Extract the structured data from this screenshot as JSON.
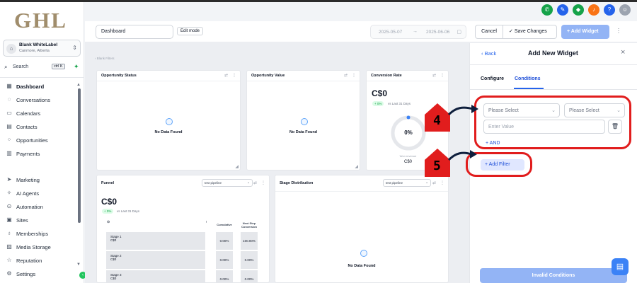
{
  "brand": {
    "logo": "GHL"
  },
  "location": {
    "name": "Blank WhiteLabel",
    "sub": "Canmore, Alberta"
  },
  "search": {
    "label": "Search",
    "shortcut": "ctrl K"
  },
  "nav": [
    {
      "label": "Dashboard",
      "icon": "dashboard-icon",
      "active": true
    },
    {
      "label": "Conversations",
      "icon": "chat-icon"
    },
    {
      "label": "Calendars",
      "icon": "calendar-icon"
    },
    {
      "label": "Contacts",
      "icon": "contacts-icon"
    },
    {
      "label": "Opportunities",
      "icon": "opportunities-icon"
    },
    {
      "label": "Payments",
      "icon": "payments-icon"
    },
    {
      "label": "Marketing",
      "icon": "send-icon"
    },
    {
      "label": "AI Agents",
      "icon": "ai-icon"
    },
    {
      "label": "Automation",
      "icon": "automation-icon"
    },
    {
      "label": "Sites",
      "icon": "sites-icon"
    },
    {
      "label": "Memberships",
      "icon": "memberships-icon"
    },
    {
      "label": "Media Storage",
      "icon": "media-icon"
    },
    {
      "label": "Reputation",
      "icon": "star-icon"
    },
    {
      "label": "Settings",
      "icon": "gear-icon"
    }
  ],
  "toolbar": {
    "dashboard_name": "Dashboard",
    "edit_mode": "Edit mode",
    "date_from": "2025-05-07",
    "date_to": "2025-06-06",
    "cancel": "Cancel",
    "save": "Save Changes",
    "add_widget": "Add Widget"
  },
  "canvas": {
    "breadcrumb": "‹ Blank Filters",
    "widgets": {
      "opportunity_status": {
        "title": "Opportunity Status",
        "empty": "No Data Found"
      },
      "opportunity_value": {
        "title": "Opportunity Value",
        "empty": "No Data Found"
      },
      "conversion_rate": {
        "title": "Conversion Rate",
        "value": "C$0",
        "badge": "+ 0%",
        "vs": "vs Last 31 Days",
        "gauge": "0%",
        "gauge_fraction": 0,
        "won_label": "Won revenue",
        "won_value": "C$0"
      },
      "funnel": {
        "title": "Funnel",
        "pipeline": "test pipeline",
        "value": "C$0",
        "badge": "+ 0%",
        "vs": "vs Last 31 Days",
        "col_stage": "⊙",
        "col_cumulative": "Cumulative",
        "col_next": "Next Step Conversion",
        "rows": [
          {
            "stage": "Stage 1",
            "amount": "C$0",
            "cumulative": "0.00%",
            "next": "100.00%"
          },
          {
            "stage": "Stage 2",
            "amount": "C$0",
            "cumulative": "0.00%",
            "next": "0.00%"
          },
          {
            "stage": "Stage 3",
            "amount": "C$0",
            "cumulative": "0.00%",
            "next": "0.00%"
          }
        ]
      },
      "stage_distribution": {
        "title": "Stage Distribution",
        "pipeline": "test pipeline",
        "empty": "No Data Found"
      }
    }
  },
  "panel": {
    "back": "‹ Back",
    "title": "Add New Widget",
    "tabs": [
      "Configure",
      "Conditions"
    ],
    "select1": "Please Select",
    "select2": "Please Select",
    "value_placeholder": "Enter Value",
    "and": "+ AND",
    "add_filter": "+ Add Filter",
    "invalid": "Invalid Conditions"
  },
  "annotations": {
    "step4": "4",
    "step5": "5",
    "color": "#e11d1d"
  },
  "colors": {
    "accent": "#2563eb",
    "brand_gold": "#a08d6c",
    "success": "#22c55e"
  }
}
